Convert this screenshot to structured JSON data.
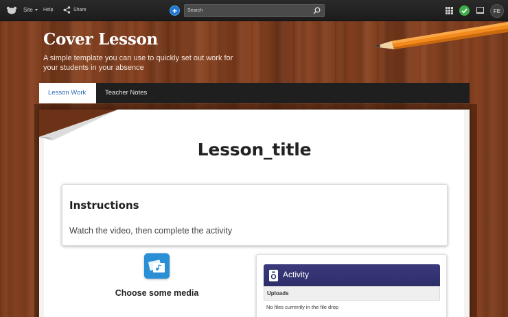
{
  "topbar": {
    "site_label": "Site",
    "help_label": "Help",
    "share_label": "Share",
    "add_label": "+",
    "search_placeholder": "Search",
    "avatar_initials": "FE",
    "icons": [
      "logo-icon",
      "share-icon",
      "add-icon",
      "search-icon",
      "apps-icon",
      "status-check-icon",
      "device-icon"
    ]
  },
  "banner": {
    "title": "Cover Lesson",
    "subtitle": "A simple template you can use to quickly set out work for your students in your absence"
  },
  "tabs": [
    {
      "label": "Lesson Work",
      "active": true
    },
    {
      "label": "Teacher Notes",
      "active": false
    }
  ],
  "lesson": {
    "title": "Lesson_title"
  },
  "instructions": {
    "heading": "Instructions",
    "text": "Watch the video, then complete the activity"
  },
  "media": {
    "label": "Choose some media"
  },
  "activity": {
    "title": "Activity",
    "uploads_label": "Uploads",
    "empty_message": "No files currently in the file drop"
  },
  "colors": {
    "topbar": "#1f1f1f",
    "tab_active_text": "#2a6bb3",
    "activity_header": "#33336f",
    "status_green": "#3fae49",
    "add_blue": "#1f77d4"
  }
}
